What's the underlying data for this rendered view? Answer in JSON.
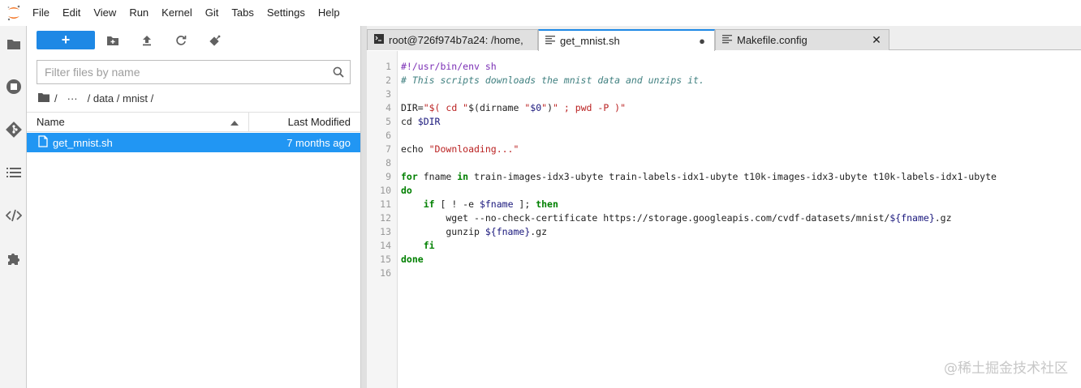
{
  "menubar": {
    "items": [
      "File",
      "Edit",
      "View",
      "Run",
      "Kernel",
      "Git",
      "Tabs",
      "Settings",
      "Help"
    ]
  },
  "filebrowser": {
    "new_label": "+",
    "search_placeholder": "Filter files by name",
    "breadcrumb": {
      "sep1": "/",
      "ellipsis": "···",
      "path": "/ data / mnist /"
    },
    "columns": {
      "name": "Name",
      "modified": "Last Modified"
    },
    "files": [
      {
        "name": "get_mnist.sh",
        "modified": "7 months ago"
      }
    ]
  },
  "tabs": [
    {
      "label": "root@726f974b7a24: /home,",
      "close": "✕"
    },
    {
      "label": "get_mnist.sh",
      "close": "●"
    },
    {
      "label": "Makefile.config",
      "close": "✕"
    }
  ],
  "editor": {
    "line_numbers": [
      "1",
      "2",
      "3",
      "4",
      "5",
      "6",
      "7",
      "8",
      "9",
      "10",
      "11",
      "12",
      "13",
      "14",
      "15",
      "16"
    ],
    "lines": [
      "#!/usr/bin/env sh",
      "# This scripts downloads the mnist data and unzips it.",
      "",
      "DIR=\"$( cd \"$(dirname \"$0\")\" ; pwd -P )\"",
      "cd $DIR",
      "",
      "echo \"Downloading...\"",
      "",
      "for fname in train-images-idx3-ubyte train-labels-idx1-ubyte t10k-images-idx3-ubyte t10k-labels-idx1-ubyte",
      "do",
      "    if [ ! -e $fname ]; then",
      "        wget --no-check-certificate https://storage.googleapis.com/cvdf-datasets/mnist/${fname}.gz",
      "        gunzip ${fname}.gz",
      "    fi",
      "done",
      ""
    ]
  },
  "watermark": "@稀土掘金技术社区",
  "colors": {
    "accent": "#1e88e5",
    "selection": "#2196f3",
    "logo": "#f37626"
  }
}
